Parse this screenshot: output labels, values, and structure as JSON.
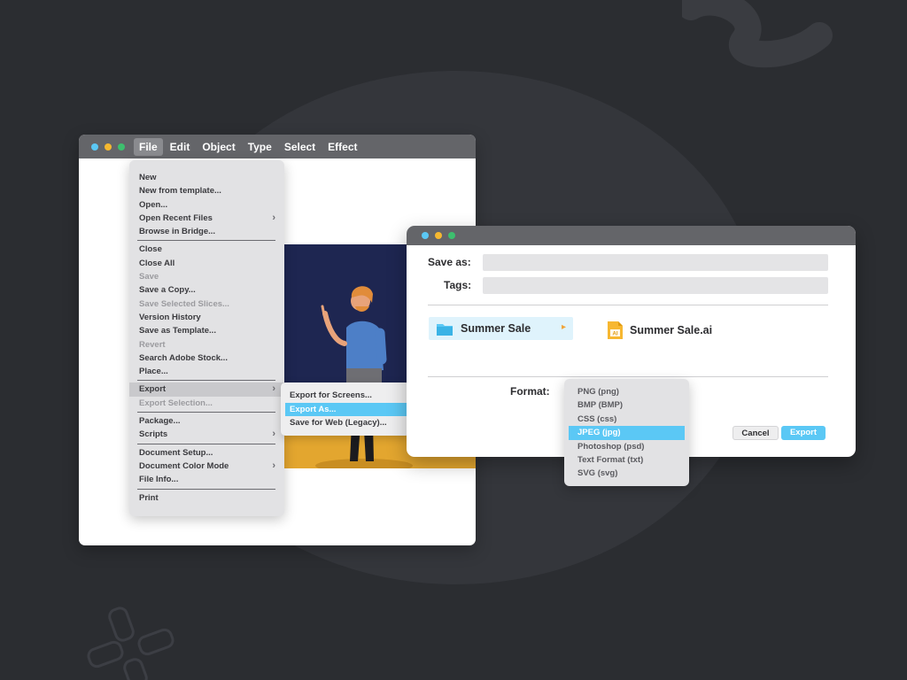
{
  "colors": {
    "background": "#2b2d31",
    "titlebar": "#646569",
    "accent": "#5bc8f5",
    "window_dot_colors": [
      "#5bc8f5",
      "#f5b830",
      "#3dbf6e"
    ]
  },
  "app": {
    "menubar": [
      "File",
      "Edit",
      "Object",
      "Type",
      "Select",
      "Effect"
    ],
    "active_menu": "File",
    "file_menu": {
      "groups": [
        [
          {
            "label": "New"
          },
          {
            "label": "New from template..."
          },
          {
            "label": "Open..."
          },
          {
            "label": "Open Recent Files",
            "submenu": true
          },
          {
            "label": "Browse in Bridge..."
          }
        ],
        [
          {
            "label": "Close"
          },
          {
            "label": "Close All"
          },
          {
            "label": "Save",
            "disabled": true
          },
          {
            "label": "Save a Copy..."
          },
          {
            "label": "Save Selected Slices...",
            "disabled": true
          },
          {
            "label": "Version History"
          },
          {
            "label": "Save as Template..."
          },
          {
            "label": "Revert",
            "disabled": true
          },
          {
            "label": "Search Adobe Stock..."
          },
          {
            "label": "Place..."
          }
        ],
        [
          {
            "label": "Export",
            "submenu": true,
            "highlighted": true
          },
          {
            "label": "Export Selection...",
            "disabled": true
          }
        ],
        [
          {
            "label": "Package..."
          },
          {
            "label": "Scripts",
            "submenu": true
          }
        ],
        [
          {
            "label": "Document Setup..."
          },
          {
            "label": "Document Color Mode",
            "submenu": true
          },
          {
            "label": "File Info..."
          }
        ],
        [
          {
            "label": "Print"
          }
        ]
      ]
    },
    "export_submenu": {
      "items": [
        "Export for Screens...",
        "Export As...",
        "Save for Web (Legacy)..."
      ],
      "selected": "Export As..."
    }
  },
  "dialog": {
    "save_as_label": "Save as:",
    "save_as_value": "",
    "tags_label": "Tags:",
    "tags_value": "",
    "folder": "Summer Sale",
    "file": "Summer Sale.ai",
    "file_icon_text": "AI",
    "format_label": "Format:",
    "formats": [
      "PNG (png)",
      "BMP (BMP)",
      "CSS (css)",
      "JPEG (jpg)",
      "Photoshop (psd)",
      "Text Format (txt)",
      "SVG (svg)"
    ],
    "selected_format": "JPEG (jpg)",
    "cancel_label": "Cancel",
    "export_label": "Export"
  }
}
